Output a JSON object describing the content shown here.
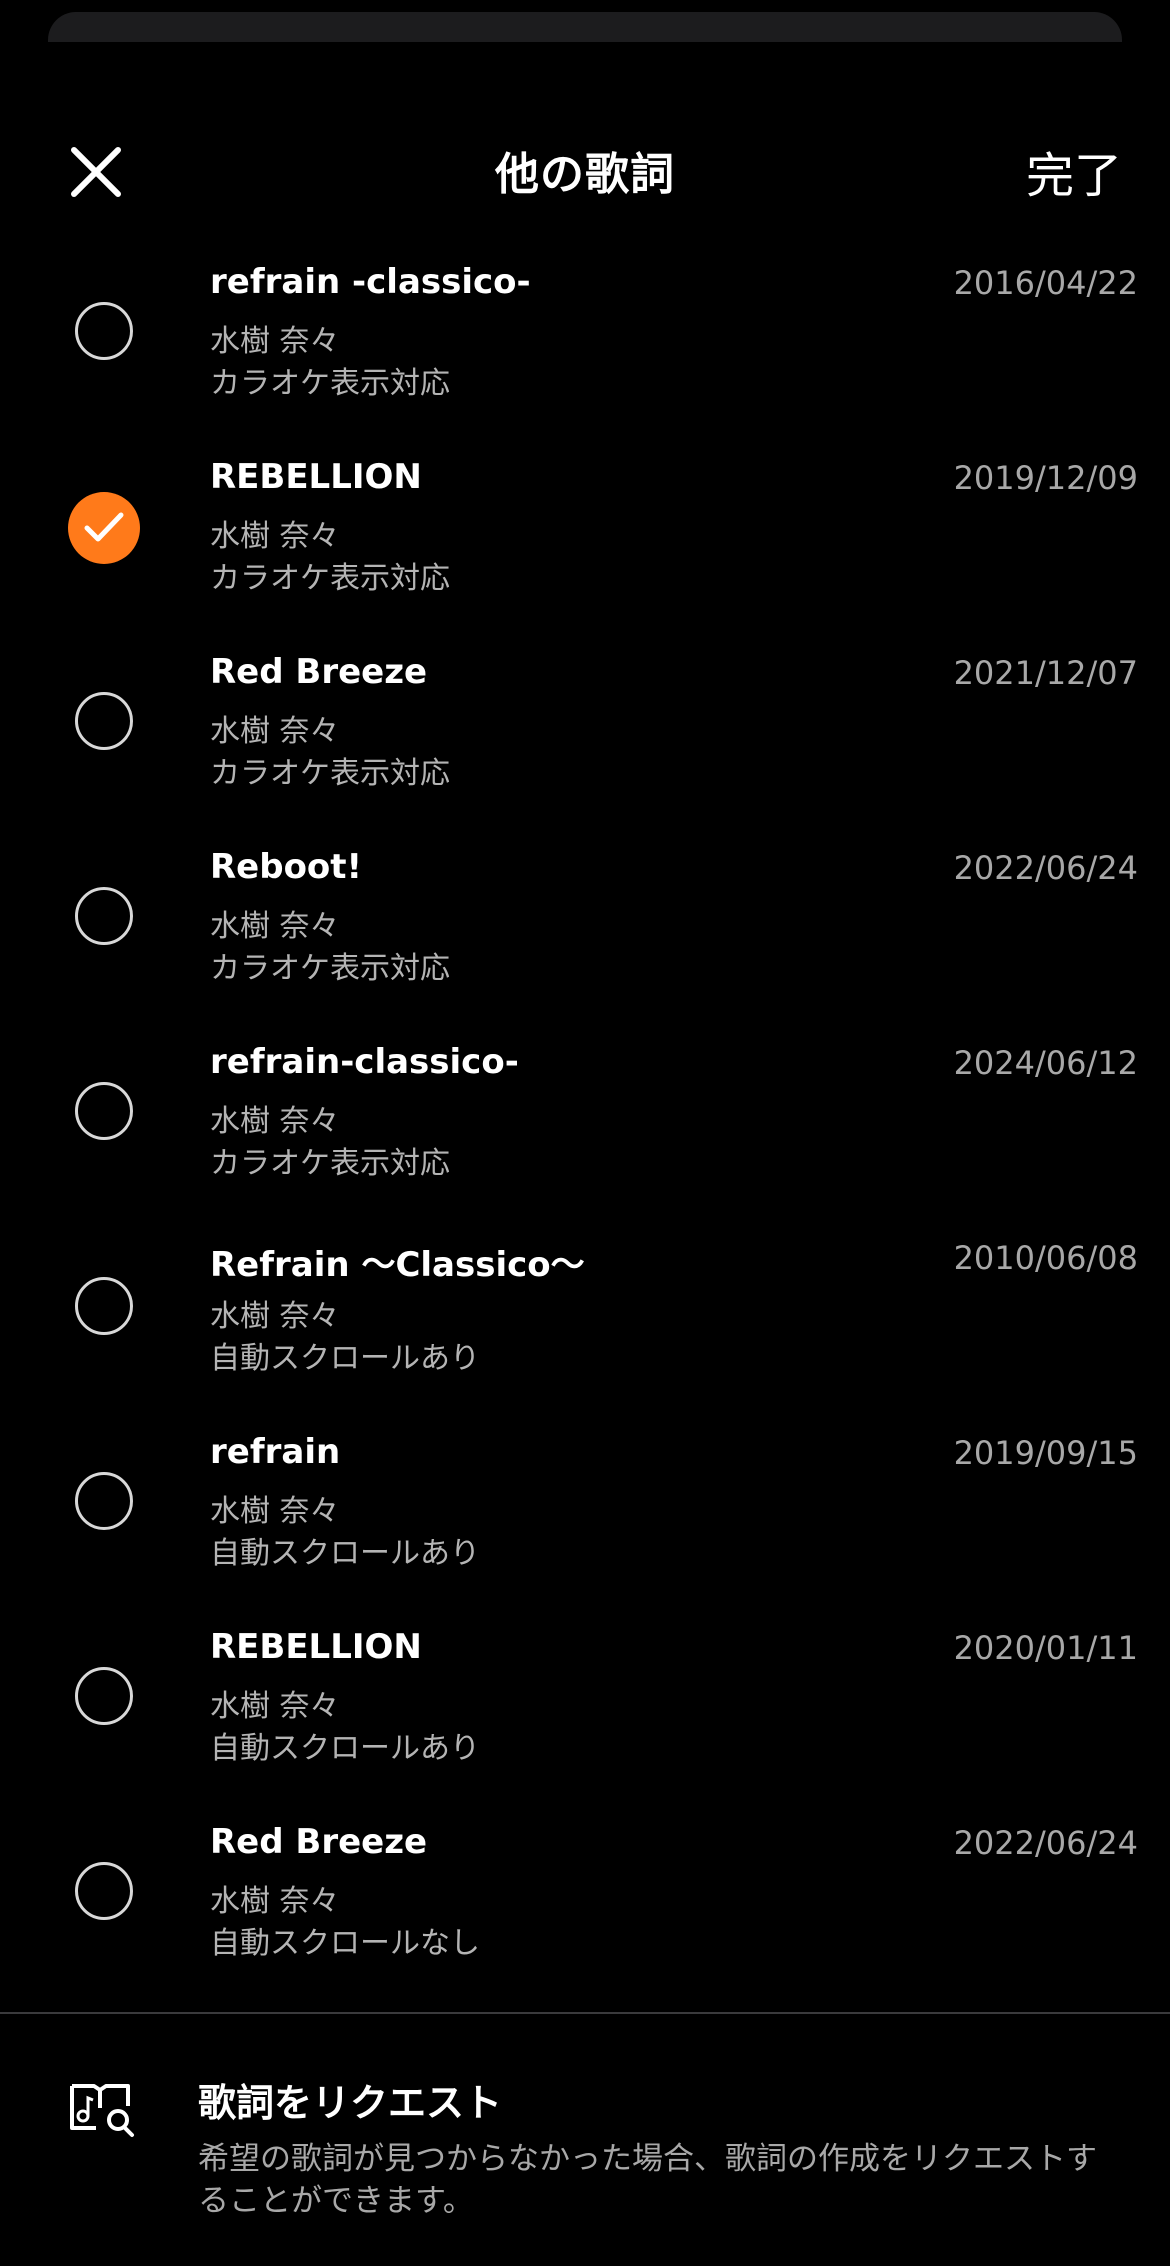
{
  "header": {
    "title": "他の歌詞",
    "done_label": "完了"
  },
  "lyrics": [
    {
      "title": "refrain -classico-",
      "artist": "水樹 奈々",
      "note": "カラオケ表示対応",
      "date": "2016/04/22",
      "selected": false
    },
    {
      "title": "REBELLION",
      "artist": "水樹 奈々",
      "note": "カラオケ表示対応",
      "date": "2019/12/09",
      "selected": true
    },
    {
      "title": "Red Breeze",
      "artist": "水樹 奈々",
      "note": "カラオケ表示対応",
      "date": "2021/12/07",
      "selected": false
    },
    {
      "title": "Reboot!",
      "artist": "水樹 奈々",
      "note": "カラオケ表示対応",
      "date": "2022/06/24",
      "selected": false
    },
    {
      "title": "refrain-classico-",
      "artist": "水樹 奈々",
      "note": "カラオケ表示対応",
      "date": "2024/06/12",
      "selected": false
    },
    {
      "title": "Refrain 〜Classico〜",
      "artist": "水樹 奈々",
      "note": "自動スクロールあり",
      "date": "2010/06/08",
      "selected": false
    },
    {
      "title": "refrain",
      "artist": "水樹 奈々",
      "note": "自動スクロールあり",
      "date": "2019/09/15",
      "selected": false
    },
    {
      "title": "REBELLION",
      "artist": "水樹 奈々",
      "note": "自動スクロールあり",
      "date": "2020/01/11",
      "selected": false
    },
    {
      "title": "Red Breeze",
      "artist": "水樹 奈々",
      "note": "自動スクロールなし",
      "date": "2022/06/24",
      "selected": false
    }
  ],
  "request": {
    "title": "歌詞をリクエスト",
    "description": "希望の歌詞が見つからなかった場合、歌詞の作成をリクエストすることができます。"
  },
  "colors": {
    "accent": "#ff7a1a",
    "background": "#000000",
    "secondary_text": "#b4b4b4"
  }
}
